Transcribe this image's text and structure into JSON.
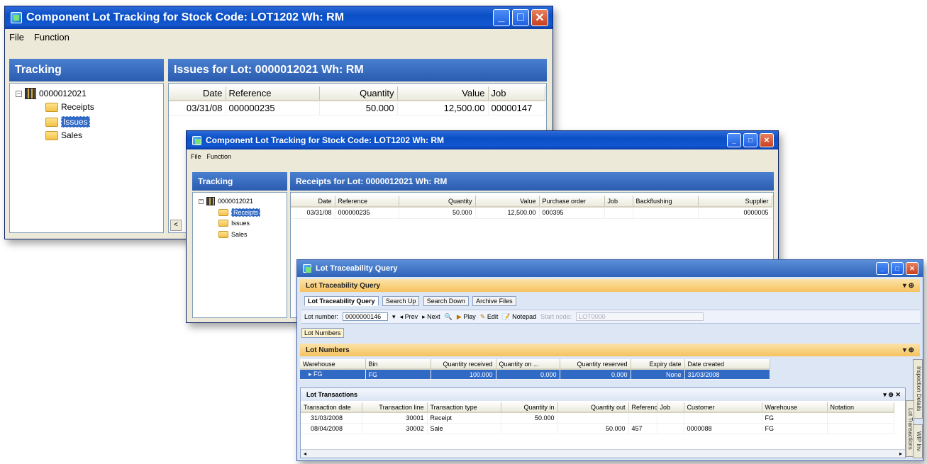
{
  "win1": {
    "title": "Component Lot Tracking for Stock Code: LOT1202 Wh: RM",
    "menu": [
      "File",
      "Function"
    ],
    "tracking_title": "Tracking",
    "tree": {
      "root": "0000012021",
      "children": [
        "Receipts",
        "Issues",
        "Sales"
      ],
      "selected": "Issues"
    },
    "panel_title": "Issues for Lot: 0000012021 Wh: RM",
    "columns": [
      "Date",
      "Reference",
      "Quantity",
      "Value",
      "Job"
    ],
    "rows": [
      [
        "03/31/08",
        "000000235",
        "50.000",
        "12,500.00",
        "00000147"
      ]
    ]
  },
  "win2": {
    "title": "Component Lot Tracking for Stock Code: LOT1202 Wh: RM",
    "menu": [
      "File",
      "Function"
    ],
    "tracking_title": "Tracking",
    "tree": {
      "root": "0000012021",
      "children": [
        "Receipts",
        "Issues",
        "Sales"
      ],
      "selected": "Receipts"
    },
    "panel_title": "Receipts for Lot: 0000012021 Wh: RM",
    "columns": [
      "Date",
      "Reference",
      "Quantity",
      "Value",
      "Purchase order",
      "Job",
      "Backflushing",
      "Supplier"
    ],
    "rows": [
      [
        "03/31/08",
        "000000235",
        "50.000",
        "12,500.00",
        "000395",
        "",
        "",
        "0000005"
      ]
    ]
  },
  "win3": {
    "title": "Lot Traceability Query",
    "section_title": "Lot Traceability Query",
    "tabs": [
      "Lot Traceability Query",
      "Search Up",
      "Search Down",
      "Archive Files"
    ],
    "toolbar": {
      "lot_label": "Lot number:",
      "lot_value": "0000000146",
      "prev": "Prev",
      "next": "Next",
      "play": "Play",
      "edit": "Edit",
      "notepad": "Notepad",
      "disabled_label": "Start node:",
      "disabled_value": "LOT0000"
    },
    "lot_numbers_button": "Lot Numbers",
    "lot_numbers_title": "Lot Numbers",
    "lot_numbers_columns": [
      "Warehouse",
      "Bin",
      "Quantity received",
      "Quantity on ...",
      "Quantity reserved",
      "Expiry date",
      "Date created"
    ],
    "lot_numbers_rows": [
      [
        "FG",
        "FG",
        "100.000",
        "0.000",
        "0.000",
        "None",
        "31/03/2008"
      ]
    ],
    "transactions_title": "Lot Transactions",
    "transactions_columns": [
      "Transaction date",
      "Transaction line",
      "Transaction type",
      "Quantity in",
      "Quantity out",
      "Reference",
      "Job",
      "Customer",
      "Warehouse",
      "Notation"
    ],
    "transactions_rows": [
      [
        "31/03/2008",
        "30001",
        "Receipt",
        "50.000",
        "",
        "",
        "",
        "",
        "FG",
        ""
      ],
      [
        "08/04/2008",
        "30002",
        "Sale",
        "",
        "50.000",
        "457",
        "",
        "0000088",
        "FG",
        ""
      ]
    ],
    "side_tabs": [
      "Inspection Details",
      "Lot Transactions",
      "WIP Inv"
    ]
  }
}
